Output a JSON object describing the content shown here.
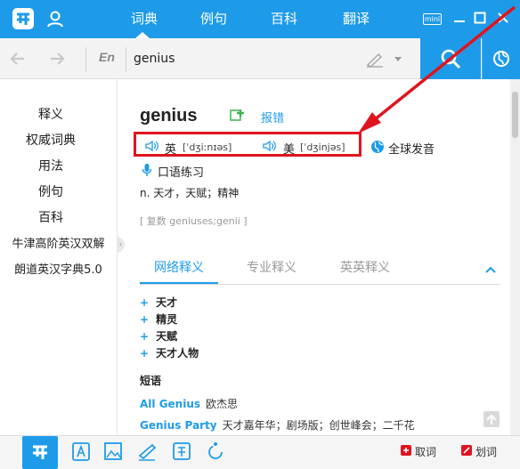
{
  "titlebar": {
    "tabs": [
      {
        "label": "词典"
      },
      {
        "label": "例句"
      },
      {
        "label": "百科"
      },
      {
        "label": "翻译"
      }
    ],
    "mini_label": "mini"
  },
  "search": {
    "lang": "En",
    "query": "genius"
  },
  "sidebar": {
    "items": [
      {
        "label": "释义"
      },
      {
        "label": "权威词典"
      },
      {
        "label": "用法"
      },
      {
        "label": "例句"
      },
      {
        "label": "百科"
      },
      {
        "label": "牛津高阶英汉双解"
      },
      {
        "label": "朗道英汉字典5.0"
      }
    ]
  },
  "entry": {
    "word": "genius",
    "report_label": "报错",
    "uk_label": "英",
    "uk_phonetic": "[ˈdʒiːnɪəs]",
    "us_label": "美",
    "us_phonetic": "[ˈdʒinjəs]",
    "global_pron_label": "全球发音",
    "oral_practice_label": "口语练习",
    "definition": "n. 天才，天赋；精神",
    "plural": "[ 复数 geniuses;genii ]"
  },
  "def_tabs": [
    {
      "label": "网络释义"
    },
    {
      "label": "专业释义"
    },
    {
      "label": "英英释义"
    }
  ],
  "meanings": [
    {
      "text": "天才"
    },
    {
      "text": "精灵"
    },
    {
      "text": "天赋"
    },
    {
      "text": "天才人物"
    }
  ],
  "phrases": {
    "heading": "短语",
    "items": [
      {
        "en": "All Genius",
        "zh": "欧杰思"
      },
      {
        "en": "Genius Party",
        "zh": "天才嘉年华；剧场版；创世峰会；二千花"
      }
    ]
  },
  "bottombar": {
    "quick_word_label": "取词",
    "select_word_label": "划词"
  },
  "colors": {
    "brand": "#1e9be8",
    "highlight": "#e0141e"
  }
}
